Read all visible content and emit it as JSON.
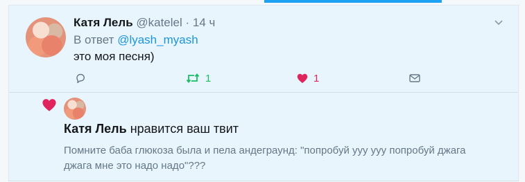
{
  "tweet": {
    "author_name": "Катя Лель",
    "author_handle": "@katelel",
    "separator": "·",
    "time": "14 ч",
    "reply_prefix": "В ответ",
    "reply_to": "@lyash_myash",
    "text": "это моя песня)",
    "retweet_count": "1",
    "like_count": "1"
  },
  "notification": {
    "actor_name": "Катя Лель",
    "action_text": "нравится ваш твит",
    "liked_tweet_text": "Помните баба глюкоза была и пела андеграунд: \"попробуй ууу ууу попробуй джага джага мне это надо надо\"???"
  },
  "colors": {
    "accent": "#1da1f2",
    "retweet": "#17bf63",
    "like": "#e0245e",
    "muted": "#657786",
    "highlight_bg": "#e8f5fd"
  },
  "icons": [
    "chevron-down-icon",
    "reply-icon",
    "retweet-icon",
    "heart-icon",
    "envelope-icon"
  ]
}
